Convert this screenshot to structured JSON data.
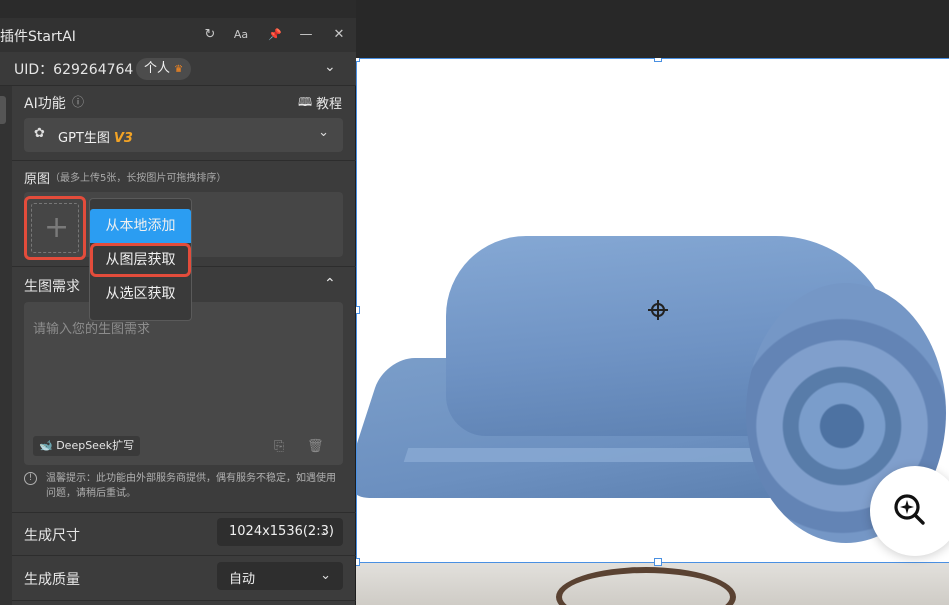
{
  "window": {
    "title": "插件StartAI"
  },
  "titlebar_icons": [
    "refresh-icon",
    "font-size-icon",
    "pin-icon",
    "minimize-icon",
    "close-icon"
  ],
  "titlebar_glyphs": {
    "refresh": "↻",
    "font": "Aa",
    "pin": "📌",
    "minimize": "—",
    "close": "✕"
  },
  "account": {
    "uid_text": "UID：629264764",
    "plan_badge": "个人",
    "crown": "♛",
    "chevron": "⌄"
  },
  "ai_function": {
    "label": "AI功能",
    "info_glyph": "ⓘ",
    "tutorial_label": "教程",
    "tutorial_glyph": "🕮",
    "model_label": "GPT生图",
    "model_version": "V3",
    "model_glyph": "✿",
    "chevron": "⌄"
  },
  "source_image": {
    "label": "原图",
    "hint": "（最多上传5张，长按图片可拖拽排序）",
    "add_glyph": "+"
  },
  "add_menu": {
    "items": [
      "从本地添加",
      "从图层获取",
      "从选区获取"
    ],
    "active_index": 0,
    "highlighted_index": 1
  },
  "prompt": {
    "label": "生图需求",
    "chevron": "⌃",
    "placeholder": "请输入您的生图需求",
    "deepseek_label": "DeepSeek扩写",
    "deepseek_glyph": "🐋",
    "icons": [
      "history-icon",
      "trash-icon"
    ],
    "history_glyph": "⎘",
    "trash_glyph": "🗑"
  },
  "notice": {
    "glyph": "!",
    "text": "温馨提示：此功能由外部服务商提供，偶有服务不稳定，如遇使用问题，请稍后重试。"
  },
  "size": {
    "label": "生成尺寸",
    "value": "1024x1536(2:3)",
    "chevron": "⌄"
  },
  "quality": {
    "label": "生成质量",
    "value": "自动",
    "chevron": "⌄"
  },
  "canvas": {
    "image_subject": "rolled blue towel",
    "selection_color": "#4a90e2",
    "accent_blue": "#2b9df2",
    "highlight_red": "#e34c3b",
    "v3_color": "#f2a325"
  }
}
